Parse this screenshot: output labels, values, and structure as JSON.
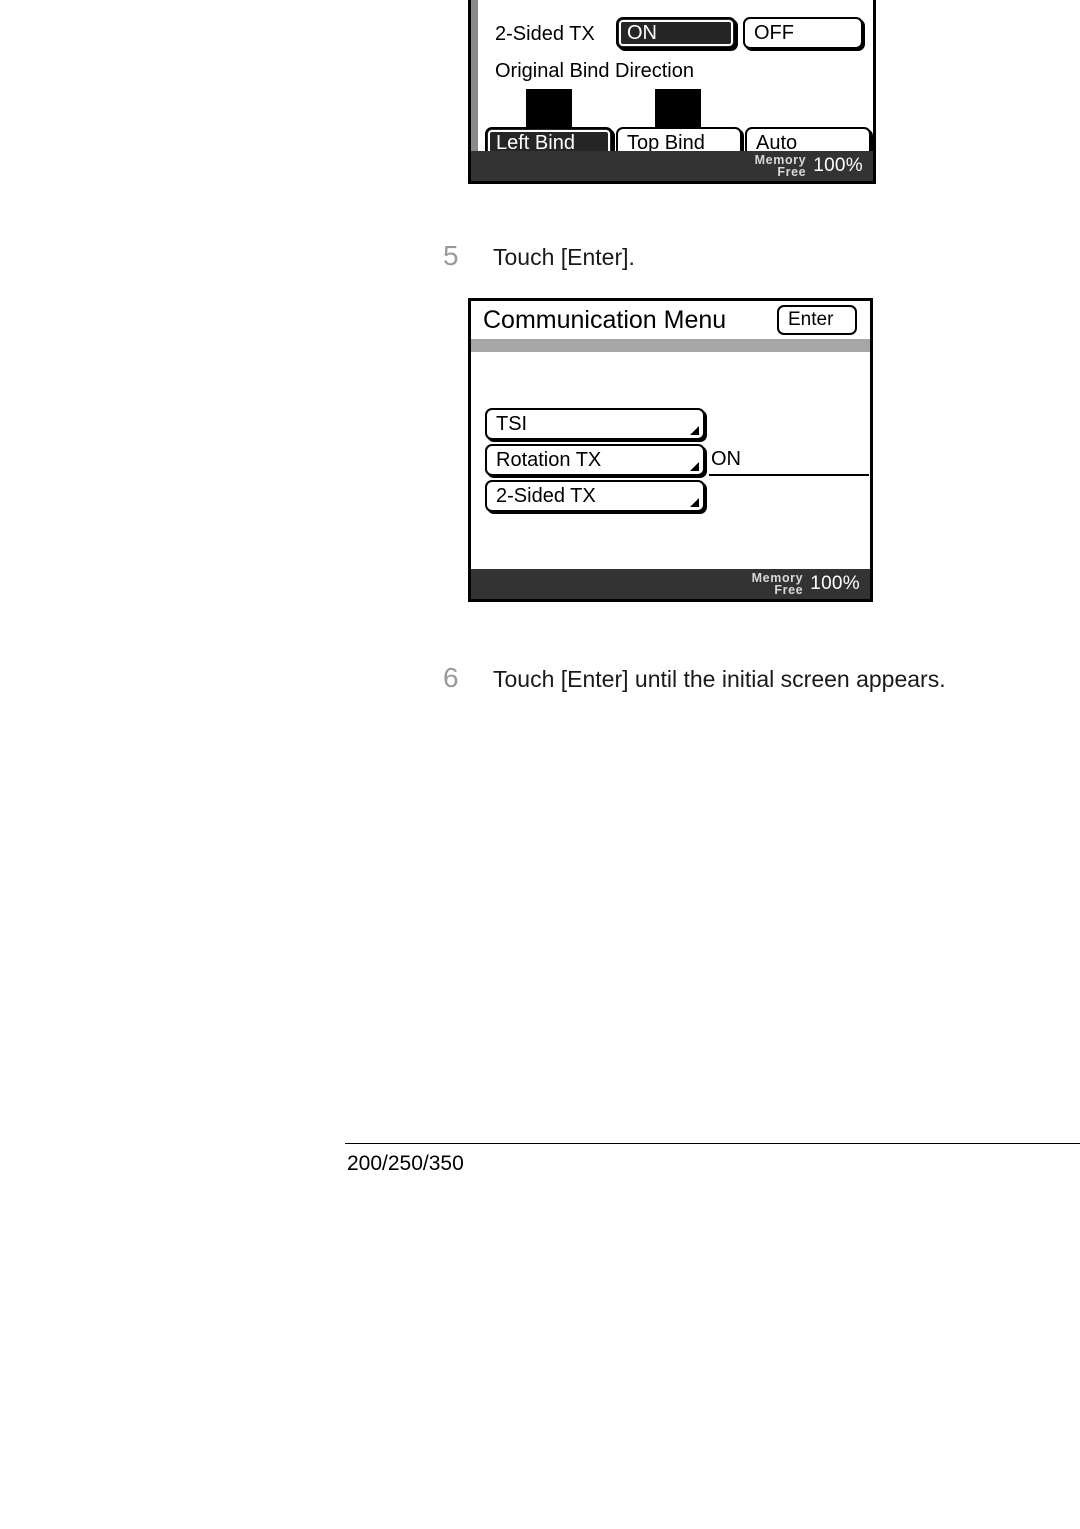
{
  "page": {
    "footer_rule": true,
    "footer_text": "200/250/350"
  },
  "panel_two_sided": {
    "name": "2-Sided TX settings screen",
    "row_label": "2-Sided TX",
    "toggle": [
      {
        "label": "ON",
        "selected": true
      },
      {
        "label": "OFF",
        "selected": false
      }
    ],
    "section_label": "Original Bind Direction",
    "bind_options": [
      {
        "label": "Left Bind",
        "selected": true,
        "has_icon": true
      },
      {
        "label": "Top Bind",
        "selected": false,
        "has_icon": true
      },
      {
        "label": "Auto",
        "selected": false,
        "has_icon": false
      }
    ],
    "status": {
      "memory_line1": "Memory",
      "memory_line2": "Free",
      "percent": "100%"
    }
  },
  "steps": [
    {
      "number": "5",
      "text": "Touch [Enter]."
    },
    {
      "number": "6",
      "text": "Touch [Enter] until the initial screen appears."
    }
  ],
  "panel_comm_menu": {
    "name": "Communication Menu screen",
    "title": "Communication Menu",
    "enter_button": "Enter",
    "items": [
      {
        "label": "TSI",
        "value": ""
      },
      {
        "label": "Rotation TX",
        "value": "ON"
      },
      {
        "label": "2-Sided TX",
        "value": ""
      }
    ],
    "status": {
      "memory_line1": "Memory",
      "memory_line2": "Free",
      "percent": "100%"
    }
  }
}
